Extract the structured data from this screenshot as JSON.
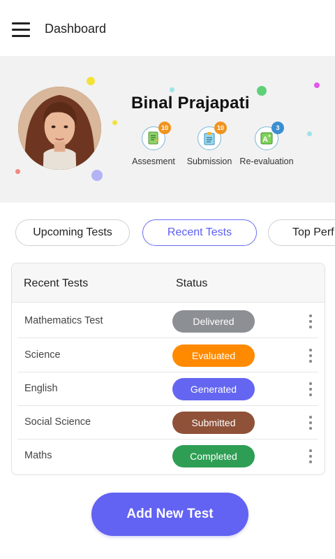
{
  "header": {
    "title": "Dashboard",
    "menu_icon": "hamburger-menu-icon"
  },
  "profile": {
    "name": "Binal Prajapati",
    "stats": [
      {
        "label": "Assesment",
        "count": "10",
        "icon": "assessment-icon",
        "badge_color": "#f0941e"
      },
      {
        "label": "Submission",
        "count": "10",
        "icon": "submission-icon",
        "badge_color": "#f0941e"
      },
      {
        "label": "Re-evaluation",
        "count": "3",
        "icon": "re-evaluation-icon",
        "badge_color": "#3a8fd1"
      }
    ]
  },
  "tabs": [
    {
      "label": "Upcoming Tests",
      "active": false
    },
    {
      "label": "Recent Tests",
      "active": true
    },
    {
      "label": "Top Perf",
      "active": false
    }
  ],
  "table": {
    "headers": {
      "name": "Recent Tests",
      "status": "Status"
    },
    "rows": [
      {
        "name": "Mathematics Test",
        "status": "Delivered",
        "color": "#8c8f94"
      },
      {
        "name": "Science",
        "status": "Evaluated",
        "color": "#ff8a00"
      },
      {
        "name": "English",
        "status": "Generated",
        "color": "#6466f1"
      },
      {
        "name": "Social Science",
        "status": "Submitted",
        "color": "#8f5138"
      },
      {
        "name": "Maths",
        "status": "Completed",
        "color": "#2e9e55"
      }
    ]
  },
  "actions": {
    "add_label": "Add New Test"
  },
  "colors": {
    "accent": "#6262f3",
    "profile_bg": "#f2f2f2"
  }
}
